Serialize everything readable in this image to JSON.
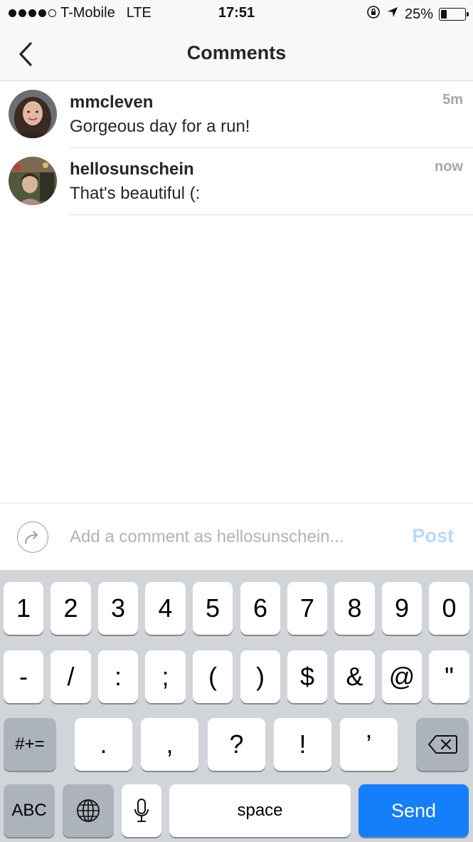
{
  "status_bar": {
    "carrier": "T-Mobile",
    "network": "LTE",
    "time": "17:51",
    "battery_percent": "25%",
    "battery_level": 0.25,
    "signal_dots_filled": 4,
    "signal_dots_total": 5
  },
  "nav": {
    "title": "Comments",
    "back_icon": "chevron-left-icon"
  },
  "comments": [
    {
      "username": "mmcleven",
      "text": "Gorgeous day for a run!",
      "time": "5m"
    },
    {
      "username": "hellosunschein",
      "text": "That's beautiful (:",
      "time": "now"
    }
  ],
  "composer": {
    "placeholder": "Add a comment as hellosunschein...",
    "value": "",
    "post_label": "Post",
    "share_icon": "share-arrow-icon"
  },
  "keyboard": {
    "row1": [
      "1",
      "2",
      "3",
      "4",
      "5",
      "6",
      "7",
      "8",
      "9",
      "0"
    ],
    "row2": [
      "-",
      "/",
      ":",
      ";",
      "(",
      ")",
      "$",
      "&",
      "@",
      "\""
    ],
    "row3": {
      "shift_label": "#+=",
      "keys": [
        ".",
        ",",
        "?",
        "!",
        "’"
      ]
    },
    "row4": {
      "abc_label": "ABC",
      "space_label": "space",
      "send_label": "Send"
    }
  },
  "colors": {
    "send_key": "#147efb",
    "post_disabled": "#b6dbf7",
    "keyboard_bg": "#d1d4d9"
  }
}
